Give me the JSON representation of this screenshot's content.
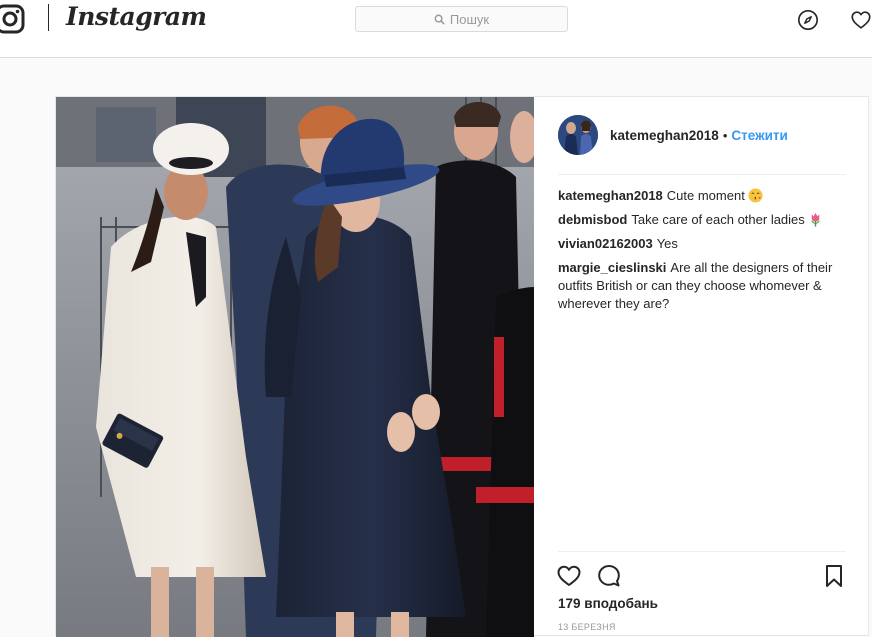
{
  "app": {
    "wordmark": "Instagram"
  },
  "search": {
    "placeholder": "Пошук",
    "icon": "search-icon"
  },
  "nav": {
    "icons": [
      "compass-icon",
      "heart-icon"
    ]
  },
  "colors": {
    "accent": "#3897f0",
    "border": "#dbdbdb",
    "background": "#fafafa",
    "text": "#262626"
  },
  "post": {
    "author": "katemeghan2018",
    "separator": "•",
    "follow_label": "Стежити",
    "comments": [
      {
        "user": "katemeghan2018",
        "text": "Cute moment",
        "emoji": "kissing-face-emoji"
      },
      {
        "user": "debmisbod",
        "text": "Take care of each other ladies",
        "emoji": "tulip-emoji"
      },
      {
        "user": "vivian02162003",
        "text": "Yes"
      },
      {
        "user": "margie_cieslinski",
        "text": "Are all the designers of their outfits British or can they choose whomever & wherever they are?"
      }
    ],
    "likes": "179 вподобань",
    "date": "13 березня"
  }
}
